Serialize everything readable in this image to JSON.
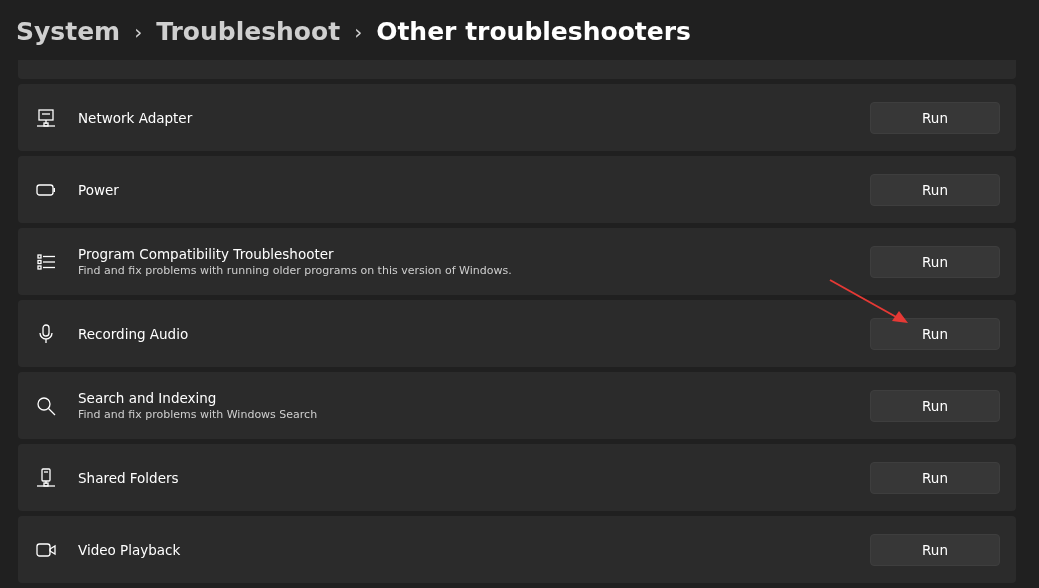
{
  "breadcrumbs": [
    {
      "label": "System",
      "selected": false
    },
    {
      "label": "Troubleshoot",
      "selected": false
    },
    {
      "label": "Other troubleshooters",
      "selected": true
    }
  ],
  "separator": "›",
  "troubleshooters": [
    {
      "kind": "network",
      "title": "Network Adapter",
      "button": "Run"
    },
    {
      "kind": "power",
      "title": "Power",
      "button": "Run"
    },
    {
      "kind": "list",
      "title": "Program Compatibility Troubleshooter",
      "description": "Find and fix problems with running older programs on this version of Windows.",
      "button": "Run"
    },
    {
      "kind": "mic",
      "title": "Recording Audio",
      "button": "Run"
    },
    {
      "kind": "search",
      "title": "Search and Indexing",
      "description": "Find and fix problems with Windows Search",
      "button": "Run"
    },
    {
      "kind": "share",
      "title": "Shared Folders",
      "button": "Run"
    },
    {
      "kind": "video",
      "title": "Video Playback",
      "button": "Run"
    }
  ]
}
